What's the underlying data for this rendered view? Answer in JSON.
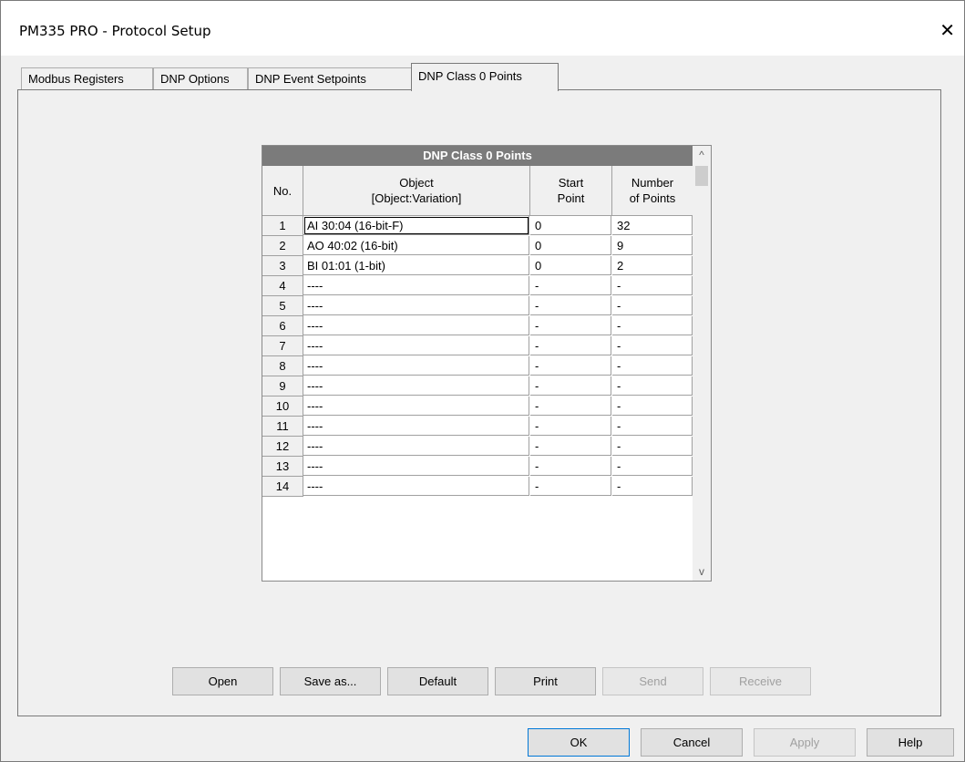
{
  "window": {
    "title": "PM335 PRO - Protocol Setup",
    "close_glyph": "✕"
  },
  "tabs": [
    {
      "label": "Modbus Registers",
      "active": false
    },
    {
      "label": "DNP Options",
      "active": false
    },
    {
      "label": "DNP Event Setpoints",
      "active": false
    },
    {
      "label": "DNP Class 0 Points",
      "active": true
    }
  ],
  "grid": {
    "title": "DNP Class 0 Points",
    "headers": {
      "no": "No.",
      "object_l1": "Object",
      "object_l2": "[Object:Variation]",
      "start_l1": "Start",
      "start_l2": "Point",
      "num_l1": "Number",
      "num_l2": "of Points"
    },
    "rows": [
      {
        "no": "1",
        "object": "AI 30:04 (16-bit-F)",
        "start": "0",
        "number": "32"
      },
      {
        "no": "2",
        "object": "AO 40:02 (16-bit)",
        "start": "0",
        "number": "9"
      },
      {
        "no": "3",
        "object": "BI 01:01 (1-bit)",
        "start": "0",
        "number": "2"
      },
      {
        "no": "4",
        "object": "----",
        "start": "-",
        "number": "-"
      },
      {
        "no": "5",
        "object": "----",
        "start": "-",
        "number": "-"
      },
      {
        "no": "6",
        "object": "----",
        "start": "-",
        "number": "-"
      },
      {
        "no": "7",
        "object": "----",
        "start": "-",
        "number": "-"
      },
      {
        "no": "8",
        "object": "----",
        "start": "-",
        "number": "-"
      },
      {
        "no": "9",
        "object": "----",
        "start": "-",
        "number": "-"
      },
      {
        "no": "10",
        "object": "----",
        "start": "-",
        "number": "-"
      },
      {
        "no": "11",
        "object": "----",
        "start": "-",
        "number": "-"
      },
      {
        "no": "12",
        "object": "----",
        "start": "-",
        "number": "-"
      },
      {
        "no": "13",
        "object": "----",
        "start": "-",
        "number": "-"
      },
      {
        "no": "14",
        "object": "----",
        "start": "-",
        "number": "-"
      }
    ],
    "scroll_up": "^",
    "scroll_down": "v"
  },
  "panel_buttons": [
    {
      "label": "Open",
      "enabled": true
    },
    {
      "label": "Save as...",
      "enabled": true
    },
    {
      "label": "Default",
      "enabled": true
    },
    {
      "label": "Print",
      "enabled": true
    },
    {
      "label": "Send",
      "enabled": false
    },
    {
      "label": "Receive",
      "enabled": false
    }
  ],
  "dialog_buttons": [
    {
      "label": "OK",
      "enabled": true
    },
    {
      "label": "Cancel",
      "enabled": true
    },
    {
      "label": "Apply",
      "enabled": false
    },
    {
      "label": "Help",
      "enabled": true
    }
  ]
}
